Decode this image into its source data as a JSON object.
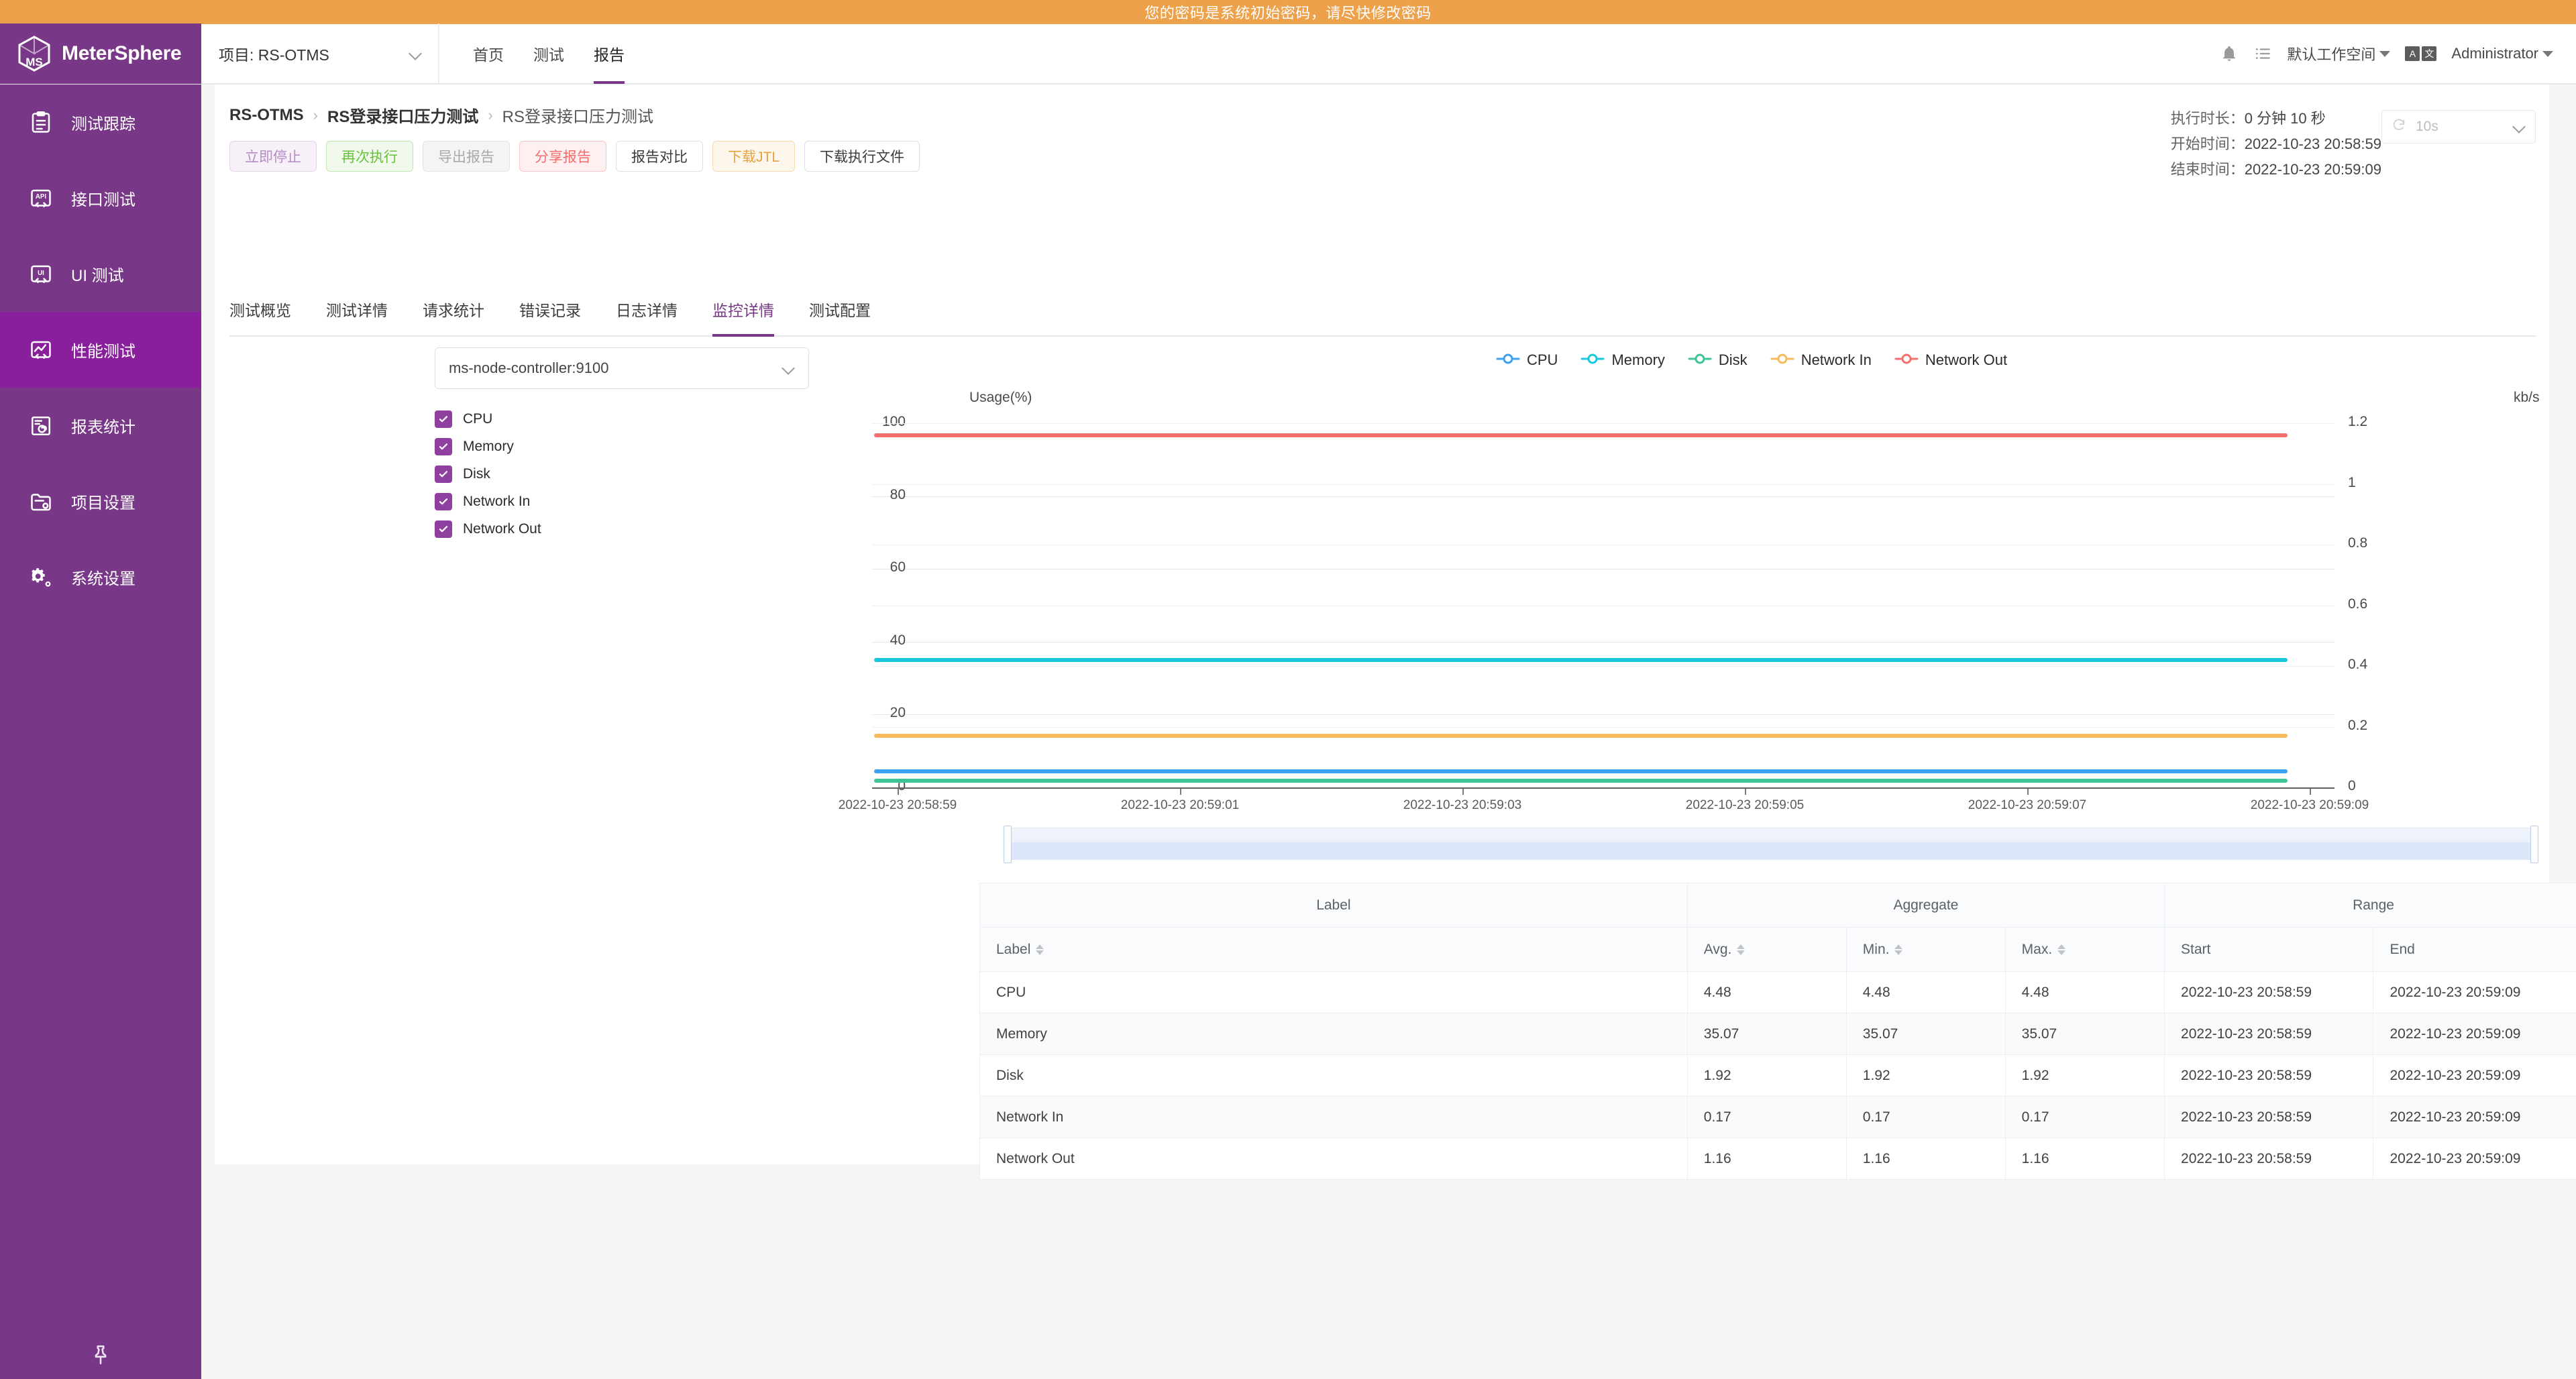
{
  "alert": {
    "message": "您的密码是系统初始密码，请尽快修改密码",
    "bg": "#eca14a"
  },
  "brand": {
    "name": "MeterSphere",
    "bg": "#783887"
  },
  "header": {
    "project_label": "项目: RS-OTMS",
    "nav": [
      {
        "label": "首页",
        "active": false
      },
      {
        "label": "测试",
        "active": false
      },
      {
        "label": "报告",
        "active": true
      }
    ],
    "bell_icon": "bell-icon",
    "tasks_icon": "task-list-icon",
    "workspace": "默认工作空间",
    "lang_icon": "translate-icon",
    "lang_a": "A",
    "lang_b": "文",
    "user": "Administrator"
  },
  "sidebar": {
    "items": [
      {
        "label": "测试跟踪",
        "icon": "clipboard-icon",
        "active": false
      },
      {
        "label": "接口测试",
        "icon": "api-icon",
        "active": false
      },
      {
        "label": "UI 测试",
        "icon": "ui-icon",
        "active": false
      },
      {
        "label": "性能测试",
        "icon": "performance-icon",
        "active": true
      },
      {
        "label": "报表统计",
        "icon": "report-chart-icon",
        "active": false
      },
      {
        "label": "项目设置",
        "icon": "folder-gear-icon",
        "active": false
      },
      {
        "label": "系统设置",
        "icon": "gear-icon",
        "active": false
      }
    ],
    "pin_icon": "pin-icon"
  },
  "breadcrumb": [
    "RS-OTMS",
    "RS登录接口压力测试",
    "RS登录接口压力测试"
  ],
  "actions": [
    {
      "label": "立即停止",
      "style": "stop"
    },
    {
      "label": "再次执行",
      "style": "rerun"
    },
    {
      "label": "导出报告",
      "style": "export"
    },
    {
      "label": "分享报告",
      "style": "share"
    },
    {
      "label": "报告对比",
      "style": "plain"
    },
    {
      "label": "下载JTL",
      "style": "jtl"
    },
    {
      "label": "下载执行文件",
      "style": "plain"
    }
  ],
  "exec_info": {
    "duration_label": "执行时长：",
    "duration_value": "0 分钟 10 秒",
    "start_label": "开始时间：",
    "start_value": "2022-10-23 20:58:59",
    "end_label": "结束时间：",
    "end_value": "2022-10-23 20:59:09"
  },
  "refresh": {
    "value": "10s",
    "icon": "refresh-icon"
  },
  "tabs": [
    {
      "label": "测试概览",
      "active": false
    },
    {
      "label": "测试详情",
      "active": false
    },
    {
      "label": "请求统计",
      "active": false
    },
    {
      "label": "错误记录",
      "active": false
    },
    {
      "label": "日志详情",
      "active": false
    },
    {
      "label": "监控详情",
      "active": true
    },
    {
      "label": "测试配置",
      "active": false
    }
  ],
  "node_select": {
    "value": "ms-node-controller:9100"
  },
  "metrics": [
    {
      "label": "CPU",
      "checked": true
    },
    {
      "label": "Memory",
      "checked": true
    },
    {
      "label": "Disk",
      "checked": true
    },
    {
      "label": "Network In",
      "checked": true
    },
    {
      "label": "Network Out",
      "checked": true
    }
  ],
  "chart_data": {
    "type": "line",
    "title": "",
    "ylabel": "Usage(%)",
    "y2label": "kb/s",
    "xlabel": "",
    "ylim": [
      0,
      100
    ],
    "y2lim": [
      0,
      1.2
    ],
    "yticks": [
      "0",
      "20",
      "40",
      "60",
      "80",
      "100"
    ],
    "y2ticks": [
      "0",
      "0.2",
      "0.4",
      "0.6",
      "0.8",
      "1",
      "1.2"
    ],
    "grid": true,
    "legend_position": "top",
    "x": [
      "2022-10-23 20:58:59",
      "2022-10-23 20:59:01",
      "2022-10-23 20:59:03",
      "2022-10-23 20:59:05",
      "2022-10-23 20:59:07",
      "2022-10-23 20:59:09"
    ],
    "series": [
      {
        "name": "CPU",
        "color": "#3ba1f2",
        "axis": "left",
        "unit": "%",
        "values": [
          4.48,
          4.48,
          4.48,
          4.48,
          4.48,
          4.48
        ]
      },
      {
        "name": "Memory",
        "color": "#19c8dd",
        "axis": "left",
        "unit": "%",
        "values": [
          35.07,
          35.07,
          35.07,
          35.07,
          35.07,
          35.07
        ]
      },
      {
        "name": "Disk",
        "color": "#3fc49a",
        "axis": "left",
        "unit": "%",
        "values": [
          1.92,
          1.92,
          1.92,
          1.92,
          1.92,
          1.92
        ]
      },
      {
        "name": "Network In",
        "color": "#f8b95a",
        "axis": "right",
        "unit": "kb/s",
        "values": [
          0.17,
          0.17,
          0.17,
          0.17,
          0.17,
          0.17
        ]
      },
      {
        "name": "Network Out",
        "color": "#f4706f",
        "axis": "right",
        "unit": "kb/s",
        "values": [
          1.16,
          1.16,
          1.16,
          1.16,
          1.16,
          1.16
        ]
      }
    ]
  },
  "table": {
    "group_headers": [
      "Label",
      "Aggregate",
      "Range"
    ],
    "columns": [
      "Label",
      "Avg.",
      "Min.",
      "Max.",
      "Start",
      "End"
    ],
    "rows": [
      {
        "label": "CPU",
        "avg": "4.48",
        "min": "4.48",
        "max": "4.48",
        "start": "2022-10-23 20:58:59",
        "end": "2022-10-23 20:59:09"
      },
      {
        "label": "Memory",
        "avg": "35.07",
        "min": "35.07",
        "max": "35.07",
        "start": "2022-10-23 20:58:59",
        "end": "2022-10-23 20:59:09"
      },
      {
        "label": "Disk",
        "avg": "1.92",
        "min": "1.92",
        "max": "1.92",
        "start": "2022-10-23 20:58:59",
        "end": "2022-10-23 20:59:09"
      },
      {
        "label": "Network In",
        "avg": "0.17",
        "min": "0.17",
        "max": "0.17",
        "start": "2022-10-23 20:58:59",
        "end": "2022-10-23 20:59:09"
      },
      {
        "label": "Network Out",
        "avg": "1.16",
        "min": "1.16",
        "max": "1.16",
        "start": "2022-10-23 20:58:59",
        "end": "2022-10-23 20:59:09"
      }
    ]
  }
}
